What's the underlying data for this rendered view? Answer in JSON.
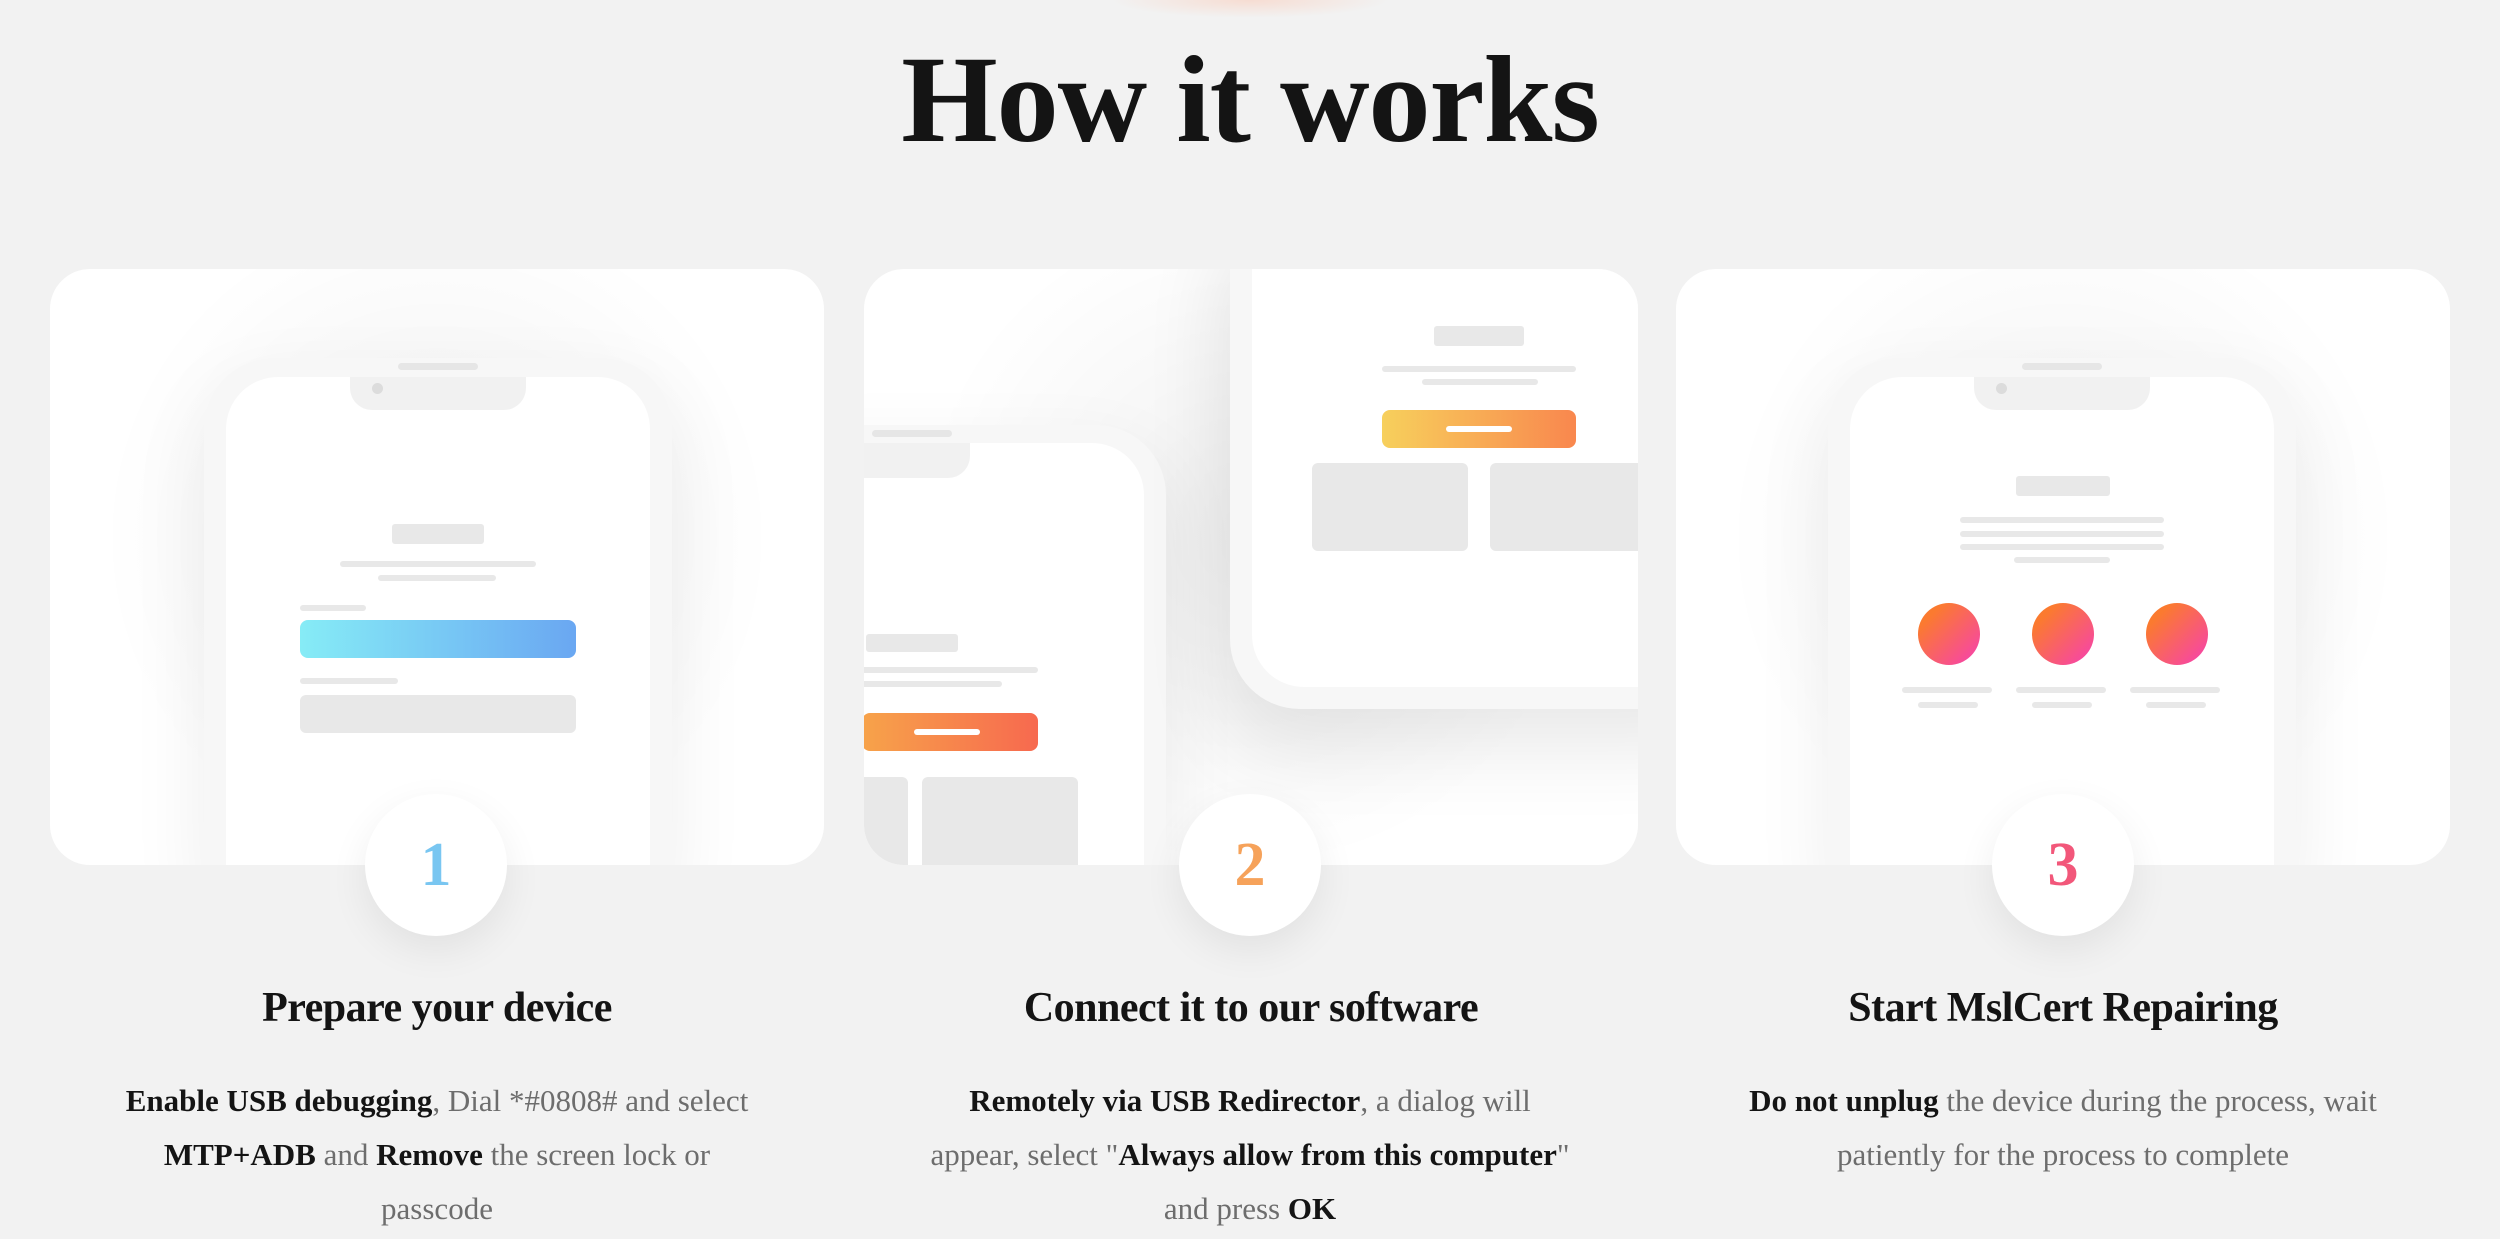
{
  "title": "How it works",
  "steps": [
    {
      "number": "1",
      "title": "Prepare your device",
      "desc": {
        "b1": "Enable USB debugging",
        "t1": ", Dial *#0808# and select ",
        "b2": "MTP+ADB",
        "t2": " and ",
        "b3": "Remove",
        "t3": " the screen lock or passcode"
      },
      "number_color": "#79c6f1"
    },
    {
      "number": "2",
      "title": "Connect it to our software",
      "desc": {
        "b1": "Remotely via USB Redirector",
        "t1": ", a dialog will appear, select \"",
        "b2": "Always allow from this computer",
        "t2": "\" and press ",
        "b3": "OK"
      },
      "number_color": "#f6a25a"
    },
    {
      "number": "3",
      "title": "Start MslCert Repairing",
      "desc": {
        "b1": "Do not unplug",
        "t1": " the device during the process, wait patiently for the process to complete"
      },
      "number_color": "#f2577a"
    }
  ],
  "colors": {
    "background": "#f2f2f2",
    "blue_gradient": [
      "#86ecf6",
      "#6aa7f2"
    ],
    "orange_gradient": [
      "#f7a34a",
      "#f7694f"
    ],
    "dot_gradient": [
      "#fb7a2f",
      "#f63fb4"
    ]
  }
}
